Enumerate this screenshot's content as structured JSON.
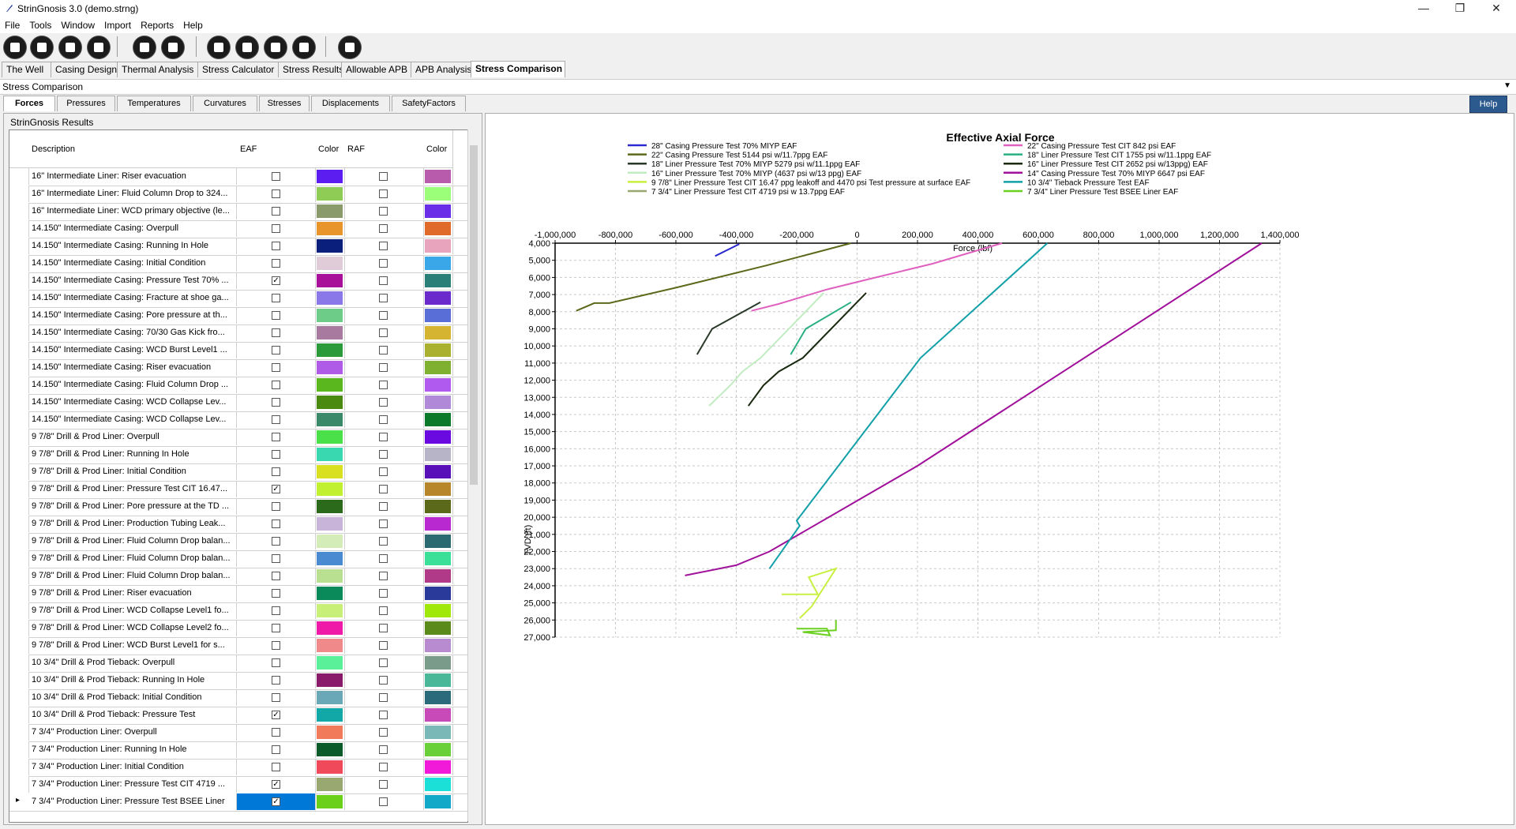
{
  "window": {
    "title": "StrinGnosis 3.0 (demo.strng)",
    "minimize": "—",
    "restore": "❐",
    "close": "✕"
  },
  "menu": [
    "File",
    "Tools",
    "Window",
    "Import",
    "Reports",
    "Help"
  ],
  "toolbar_icons": [
    "open-file-icon",
    "new-file-icon",
    "save-icon",
    "edit-icon",
    "calculator-icon",
    "pipe-fork-icon",
    "casing-icon",
    "string-icon",
    "connector-icon",
    "coil-icon",
    "drop-icon"
  ],
  "main_tabs": [
    "The Well",
    "Casing Design",
    "Thermal Analysis",
    "Stress Calculator",
    "Stress Results",
    "Allowable APB",
    "APB Analysis",
    "Stress Comparison"
  ],
  "active_main_tab": "Stress Comparison",
  "section_title": "Stress Comparison",
  "sub_tabs": [
    "Forces",
    "Pressures",
    "Temperatures",
    "Curvatures",
    "Stresses",
    "Displacements",
    "SafetyFactors"
  ],
  "active_sub_tab": "Forces",
  "help_label": "Help",
  "results_header": "StrinGnosis Results",
  "grid": {
    "columns": [
      "Description",
      "EAF",
      "Color",
      "RAF",
      "Color"
    ],
    "rows": [
      {
        "desc": "16\" Intermediate Liner: Riser evacuation",
        "eaf": false,
        "c1": "#5c1ef0",
        "c2": "#b95bad"
      },
      {
        "desc": "16\" Intermediate Liner: Fluid Column Drop to 324...",
        "eaf": false,
        "c1": "#8fcc55",
        "c2": "#9cff7a"
      },
      {
        "desc": "16\" Intermediate Liner: WCD primary objective (le...",
        "eaf": false,
        "c1": "#8a9a6a",
        "c2": "#6b2ee8"
      },
      {
        "desc": "14.150\" Intermediate Casing: Overpull",
        "eaf": false,
        "c1": "#e8962c",
        "c2": "#e06a2a"
      },
      {
        "desc": "14.150\" Intermediate Casing: Running In Hole",
        "eaf": false,
        "c1": "#0a1f7c",
        "c2": "#e8a4bc"
      },
      {
        "desc": "14.150\" Intermediate Casing: Initial Condition",
        "eaf": false,
        "c1": "#e0ccd8",
        "c2": "#3aa8e8"
      },
      {
        "desc": "14.150\" Intermediate Casing: Pressure Test 70% ...",
        "eaf": true,
        "c1": "#a8109a",
        "c2": "#2a8078"
      },
      {
        "desc": "14.150\" Intermediate Casing: Fracture at shoe ga...",
        "eaf": false,
        "c1": "#8a78e8",
        "c2": "#6a2acc"
      },
      {
        "desc": "14.150\" Intermediate Casing: Pore pressure at th...",
        "eaf": false,
        "c1": "#6ccc88",
        "c2": "#5a6ed8"
      },
      {
        "desc": "14.150\" Intermediate Casing: 70/30 Gas Kick fro...",
        "eaf": false,
        "c1": "#a87aa0",
        "c2": "#d4b430"
      },
      {
        "desc": "14.150\" Intermediate Casing: WCD Burst Level1 ...",
        "eaf": false,
        "c1": "#2a9a3a",
        "c2": "#aab030"
      },
      {
        "desc": "14.150\" Intermediate Casing: Riser evacuation",
        "eaf": false,
        "c1": "#b05ae8",
        "c2": "#80b030"
      },
      {
        "desc": "14.150\" Intermediate Casing: Fluid Column Drop ...",
        "eaf": false,
        "c1": "#5ab81e",
        "c2": "#b05af0"
      },
      {
        "desc": "14.150\" Intermediate Casing: WCD Collapse Lev...",
        "eaf": false,
        "c1": "#4a8a10",
        "c2": "#b08ad8"
      },
      {
        "desc": "14.150\" Intermediate Casing: WCD Collapse Lev...",
        "eaf": false,
        "c1": "#3a8a6a",
        "c2": "#0a7a2a"
      },
      {
        "desc": "9 7/8\" Drill & Prod Liner: Overpull",
        "eaf": false,
        "c1": "#4ae04a",
        "c2": "#6a0ae0"
      },
      {
        "desc": "9 7/8\" Drill & Prod Liner: Running In Hole",
        "eaf": false,
        "c1": "#3ad8b0",
        "c2": "#b8b4c8"
      },
      {
        "desc": "9 7/8\" Drill & Prod Liner: Initial Condition",
        "eaf": false,
        "c1": "#d8e020",
        "c2": "#5a10b8"
      },
      {
        "desc": "9 7/8\" Drill & Prod Liner: Pressure Test CIT 16.47...",
        "eaf": true,
        "c1": "#c0f030",
        "c2": "#b8862a"
      },
      {
        "desc": "9 7/8\" Drill & Prod Liner: Pore pressure at the TD ...",
        "eaf": false,
        "c1": "#2a6a1a",
        "c2": "#5a6a1a"
      },
      {
        "desc": "9 7/8\" Drill & Prod Liner: Production Tubing Leak...",
        "eaf": false,
        "c1": "#c8b4d8",
        "c2": "#b82ad0"
      },
      {
        "desc": "9 7/8\" Drill & Prod Liner: Fluid Column Drop balan...",
        "eaf": false,
        "c1": "#d4ecb8",
        "c2": "#2a6a70"
      },
      {
        "desc": "9 7/8\" Drill & Prod Liner: Fluid Column Drop balan...",
        "eaf": false,
        "c1": "#4a8ad0",
        "c2": "#3ae098"
      },
      {
        "desc": "9 7/8\" Drill & Prod Liner: Fluid Column Drop balan...",
        "eaf": false,
        "c1": "#b8e090",
        "c2": "#b03a88"
      },
      {
        "desc": "9 7/8\" Drill & Prod Liner: Riser evacuation",
        "eaf": false,
        "c1": "#0a8a5a",
        "c2": "#2a3a9a"
      },
      {
        "desc": "9 7/8\" Drill & Prod Liner: WCD Collapse Level1 fo...",
        "eaf": false,
        "c1": "#c8f078",
        "c2": "#a0e80a"
      },
      {
        "desc": "9 7/8\" Drill & Prod Liner: WCD Collapse Level2 fo...",
        "eaf": false,
        "c1": "#f01aa8",
        "c2": "#5a8a1a"
      },
      {
        "desc": "9 7/8\" Drill & Prod Liner: WCD Burst Level1 for s...",
        "eaf": false,
        "c1": "#f08a8a",
        "c2": "#b88ad0"
      },
      {
        "desc": "10 3/4\" Drill & Prod Tieback: Overpull",
        "eaf": false,
        "c1": "#5af09a",
        "c2": "#7a9a8a"
      },
      {
        "desc": "10 3/4\" Drill & Prod Tieback: Running In Hole",
        "eaf": false,
        "c1": "#8a1a6a",
        "c2": "#4ab898"
      },
      {
        "desc": "10 3/4\" Drill & Prod Tieback: Initial Condition",
        "eaf": false,
        "c1": "#6aa8b8",
        "c2": "#2a6a7a"
      },
      {
        "desc": "10 3/4\" Drill & Prod Tieback: Pressure Test",
        "eaf": true,
        "c1": "#12a8a8",
        "c2": "#c84ab8"
      },
      {
        "desc": "7 3/4\" Production Liner: Overpull",
        "eaf": false,
        "c1": "#f07a5a",
        "c2": "#7ab8b8"
      },
      {
        "desc": "7 3/4\" Production Liner: Running In Hole",
        "eaf": false,
        "c1": "#0a5a2a",
        "c2": "#6ad03a"
      },
      {
        "desc": "7 3/4\" Production Liner: Initial Condition",
        "eaf": false,
        "c1": "#f04a5a",
        "c2": "#f01ad8"
      },
      {
        "desc": "7 3/4\" Production Liner: Pressure Test CIT 4719 ...",
        "eaf": true,
        "c1": "#98a870",
        "c2": "#1ae0d8"
      },
      {
        "desc": "7 3/4\" Production Liner: Pressure Test BSEE Liner",
        "eaf": true,
        "c1": "#6ad01a",
        "c2": "#12a8c8",
        "selected": true
      }
    ]
  },
  "chart_data": {
    "type": "line",
    "title": "Effective Axial Force",
    "xlabel": "Force (lbf)",
    "ylabel": "TVD (ft)",
    "xlim": [
      -1000000,
      1400000
    ],
    "ylim": [
      4000,
      27000
    ],
    "y_inverted": true,
    "x_axis_position": "top",
    "grid": true,
    "x_ticks": [
      "-1,000,000",
      "-800,000",
      "-600,000",
      "-400,000",
      "-200,000",
      "0",
      "200,000",
      "400,000",
      "600,000",
      "800,000",
      "1,000,000",
      "1,200,000",
      "1,400,000"
    ],
    "y_ticks": [
      "4,000",
      "5,000",
      "6,000",
      "7,000",
      "8,000",
      "9,000",
      "10,000",
      "11,000",
      "12,000",
      "13,000",
      "14,000",
      "15,000",
      "16,000",
      "17,000",
      "18,000",
      "19,000",
      "20,000",
      "21,000",
      "22,000",
      "23,000",
      "24,000",
      "25,000",
      "26,000",
      "27,000"
    ],
    "legend_position": "top",
    "series": [
      {
        "name": "28\" Casing Pressure Test 70% MIYP EAF",
        "color": "#2a2ad0",
        "points": [
          [
            -470000,
            4750
          ],
          [
            -390000,
            4050
          ]
        ]
      },
      {
        "name": "22\" Casing Pressure Test CIT 842 psi EAF",
        "color": "#e060c0",
        "points": [
          [
            -350000,
            7950
          ],
          [
            -260000,
            7550
          ],
          [
            -100000,
            6700
          ],
          [
            50000,
            6050
          ],
          [
            250000,
            5200
          ],
          [
            480000,
            4000
          ]
        ]
      },
      {
        "name": "22\" Casing Pressure Test 5144 psi w/11.7ppg EAF",
        "color": "#5a6a1a",
        "points": [
          [
            -930000,
            7950
          ],
          [
            -870000,
            7500
          ],
          [
            -820000,
            7500
          ],
          [
            -600000,
            6600
          ],
          [
            -300000,
            5300
          ],
          [
            -20000,
            4000
          ]
        ]
      },
      {
        "name": "18\" Liner Pressure Test CIT 1755 psi w/11.1ppg EAF",
        "color": "#2ab080",
        "points": [
          [
            -220000,
            10500
          ],
          [
            -170000,
            9000
          ],
          [
            -20000,
            7450
          ]
        ]
      },
      {
        "name": "18\" Liner Pressure Test 70% MIYP 5279 psi w/11.1ppg EAF",
        "color": "#2a3a2a",
        "points": [
          [
            -530000,
            10500
          ],
          [
            -480000,
            9000
          ],
          [
            -320000,
            7450
          ]
        ]
      },
      {
        "name": "16\" Liner Pressure Test CIT 2652 psi w/13ppg) EAF",
        "color": "#1a2a10",
        "points": [
          [
            -360000,
            13500
          ],
          [
            -310000,
            12300
          ],
          [
            -260000,
            11500
          ],
          [
            -180000,
            10700
          ],
          [
            30000,
            6900
          ]
        ]
      },
      {
        "name": "16\" Liner Pressure Test 70% MIYP (4637 psi w/13 ppg) EAF",
        "color": "#c0ecc0",
        "points": [
          [
            -490000,
            13500
          ],
          [
            -420000,
            12300
          ],
          [
            -380000,
            11500
          ],
          [
            -320000,
            10700
          ],
          [
            -110000,
            6900
          ]
        ]
      },
      {
        "name": "14\" Casing Pressure Test 70% MIYP 6647 psi EAF",
        "color": "#a0109a",
        "points": [
          [
            -570000,
            23400
          ],
          [
            -400000,
            22800
          ],
          [
            -290000,
            22000
          ],
          [
            200000,
            17000
          ],
          [
            1340000,
            4000
          ]
        ]
      },
      {
        "name": "9 7/8\" Liner Pressure Test CIT 16.47 ppg leakoff and 4470 psi Test pressure at surface EAF",
        "color": "#c8f040",
        "points": [
          [
            -250000,
            24500
          ],
          [
            -130000,
            24500
          ],
          [
            -160000,
            23500
          ],
          [
            -70000,
            23000
          ],
          [
            -150000,
            25200
          ],
          [
            -190000,
            25900
          ]
        ]
      },
      {
        "name": "10 3/4\" Tieback Pressure Test EAF",
        "color": "#12a0a8",
        "points": [
          [
            -290000,
            23000
          ],
          [
            -190000,
            20500
          ],
          [
            -200000,
            20200
          ],
          [
            210000,
            10700
          ],
          [
            630000,
            4000
          ]
        ]
      },
      {
        "name": "7 3/4\" Liner Pressure Test CIT 4719 psi w 13.7ppg EAF",
        "color": "#98a870",
        "points": []
      },
      {
        "name": "7 3/4\" Liner Pressure Test BSEE Liner EAF",
        "color": "#6ad020",
        "points": [
          [
            -200000,
            26500
          ],
          [
            -100000,
            26500
          ],
          [
            -90000,
            26900
          ],
          [
            -180000,
            26700
          ],
          [
            -70000,
            26600
          ],
          [
            -70000,
            26000
          ]
        ]
      }
    ]
  }
}
